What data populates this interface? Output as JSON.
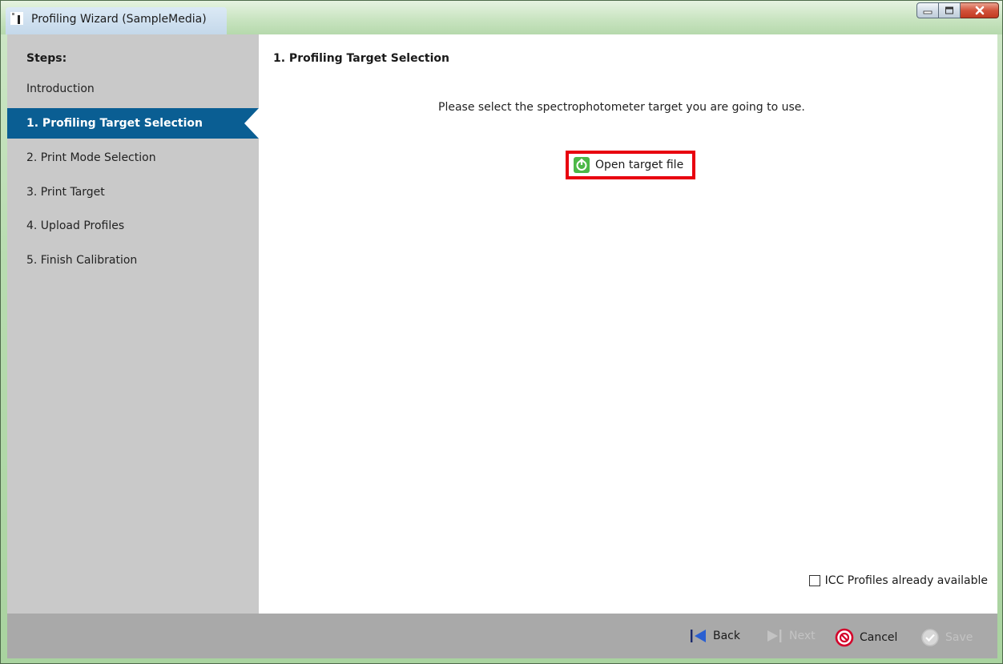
{
  "window": {
    "title": "Profiling Wizard (SampleMedia)",
    "controls": {
      "minimize_icon": "minimize-icon",
      "maximize_icon": "maximize-icon",
      "close_icon": "close-icon"
    }
  },
  "sidebar": {
    "heading": "Steps:",
    "items": [
      {
        "label": "Introduction",
        "active": false
      },
      {
        "label": "1. Profiling Target Selection",
        "active": true
      },
      {
        "label": "2. Print Mode Selection",
        "active": false
      },
      {
        "label": "3. Print Target",
        "active": false
      },
      {
        "label": "4. Upload Profiles",
        "active": false
      },
      {
        "label": "5. Finish Calibration",
        "active": false
      }
    ]
  },
  "main": {
    "title": "1. Profiling Target Selection",
    "instruction": "Please select the spectrophotometer target you are going to use.",
    "open_target_label": "Open target file",
    "icc_checkbox_label": "ICC Profiles already available",
    "icc_checked": false
  },
  "footer": {
    "back_label": "Back",
    "next_label": "Next",
    "cancel_label": "Cancel",
    "save_label": "Save"
  },
  "colors": {
    "active_step_bg": "#0a5e93",
    "sidebar_bg": "#c9c9c9",
    "footer_bg": "#a9a9a9",
    "highlight_border": "#e8000f",
    "open_icon_green": "#4cb848"
  }
}
